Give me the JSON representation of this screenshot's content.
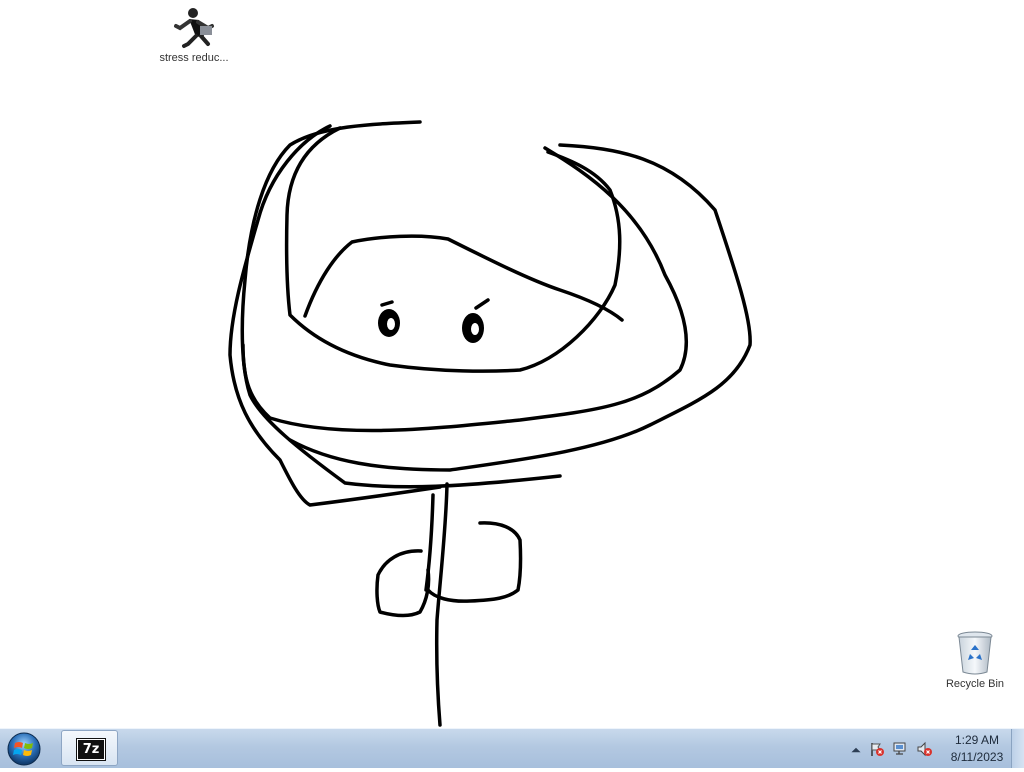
{
  "desktop": {
    "icons": [
      {
        "label": "stress reduc..."
      },
      {
        "label": "Recycle Bin"
      }
    ]
  },
  "taskbar": {
    "start_icon": "windows-orb-icon",
    "pinned": [
      {
        "app": "7-Zip",
        "glyph": "7z",
        "icon": "7zip-icon"
      }
    ],
    "tray": {
      "icons": [
        "show-hidden-icons-arrow",
        "action-center-flag-icon",
        "network-icon",
        "volume-muted-icon"
      ],
      "time": "1:29 AM",
      "date": "8/11/2023"
    }
  },
  "colors": {
    "taskbar_top": "#c8d9ec",
    "taskbar_bottom": "#a7bfdc",
    "alert_red": "#d9322c"
  }
}
